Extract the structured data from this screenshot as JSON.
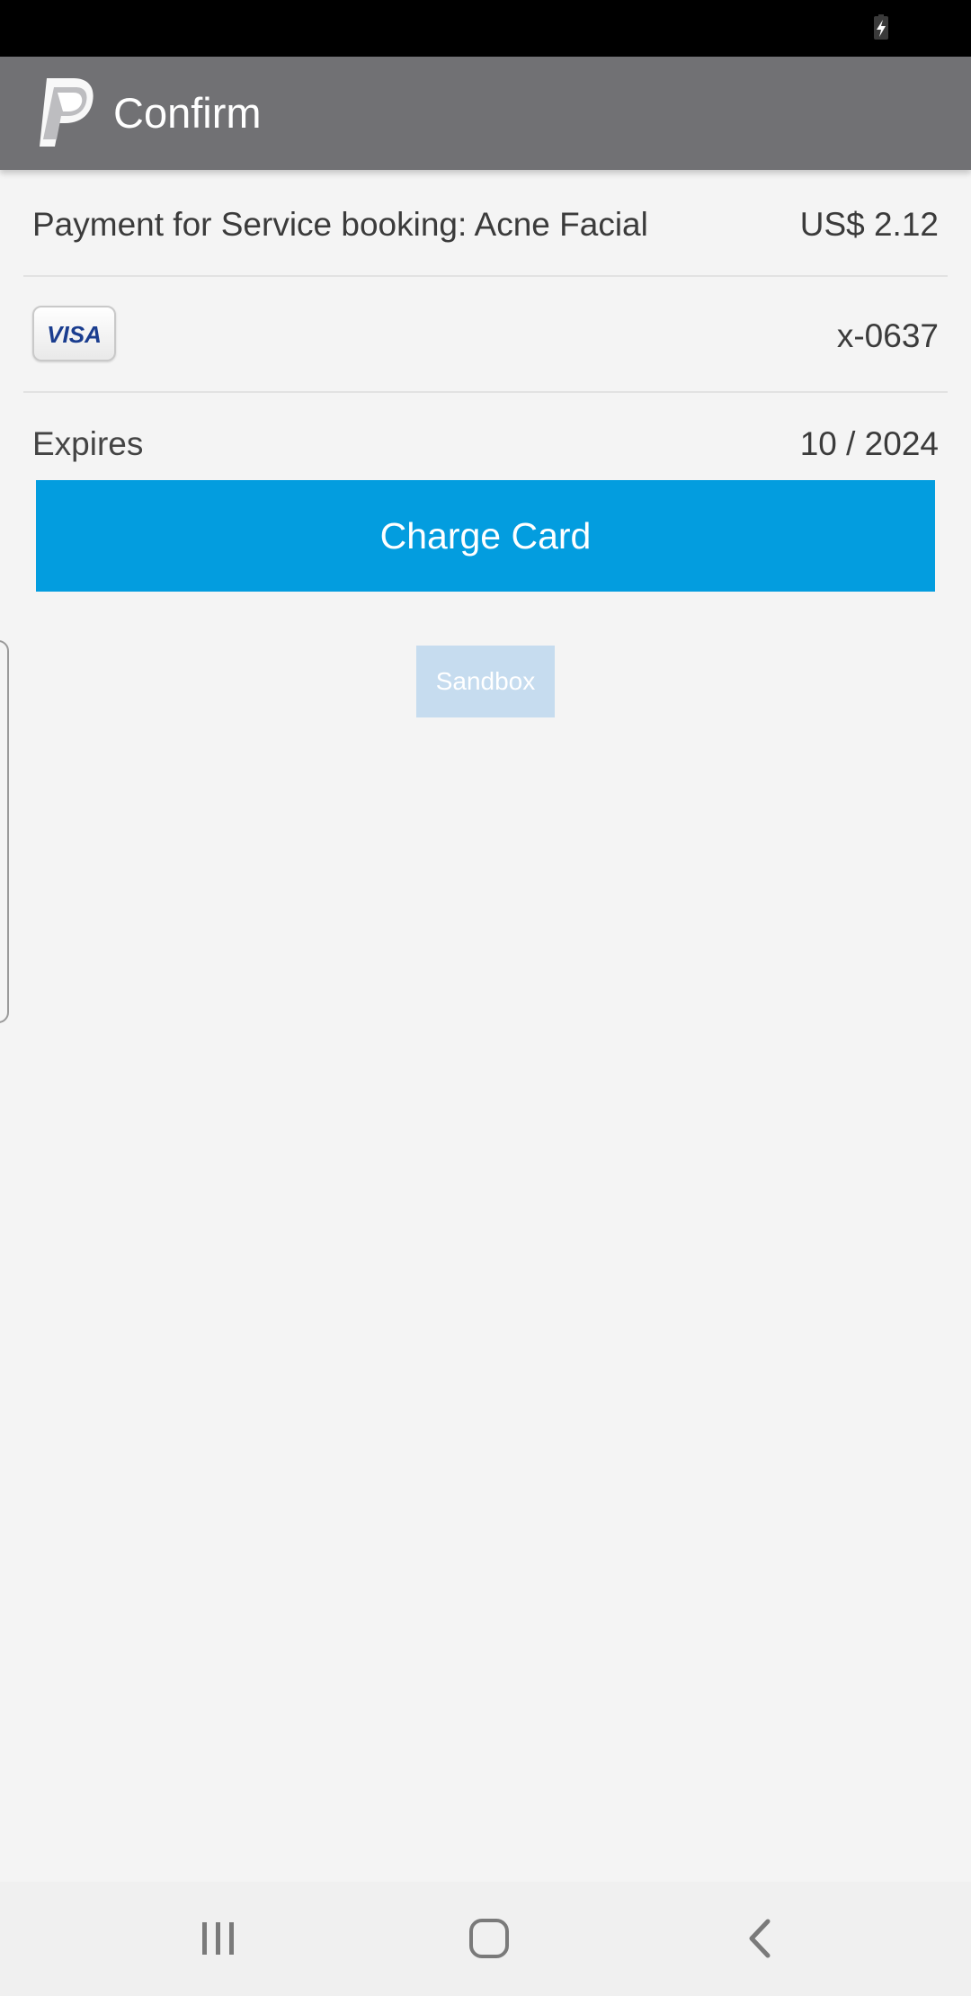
{
  "header": {
    "title": "Confirm",
    "logo_icon": "paypal-logo-icon",
    "background": "#717174"
  },
  "payment": {
    "description": "Payment for Service booking: Acne Facial",
    "amount": "US$ 2.12"
  },
  "card": {
    "brand_label": "VISA",
    "number_masked": "x-0637",
    "expires_label": "Expires",
    "expires_value": "10 / 2024"
  },
  "actions": {
    "charge_label": "Charge Card",
    "charge_color": "#039ddf"
  },
  "environment": {
    "badge_label": "Sandbox"
  },
  "status_bar": {
    "icons": [
      "battery-charging-icon"
    ]
  },
  "nav_bar": {
    "icons": [
      "recent-apps-icon",
      "home-icon",
      "back-icon"
    ]
  }
}
